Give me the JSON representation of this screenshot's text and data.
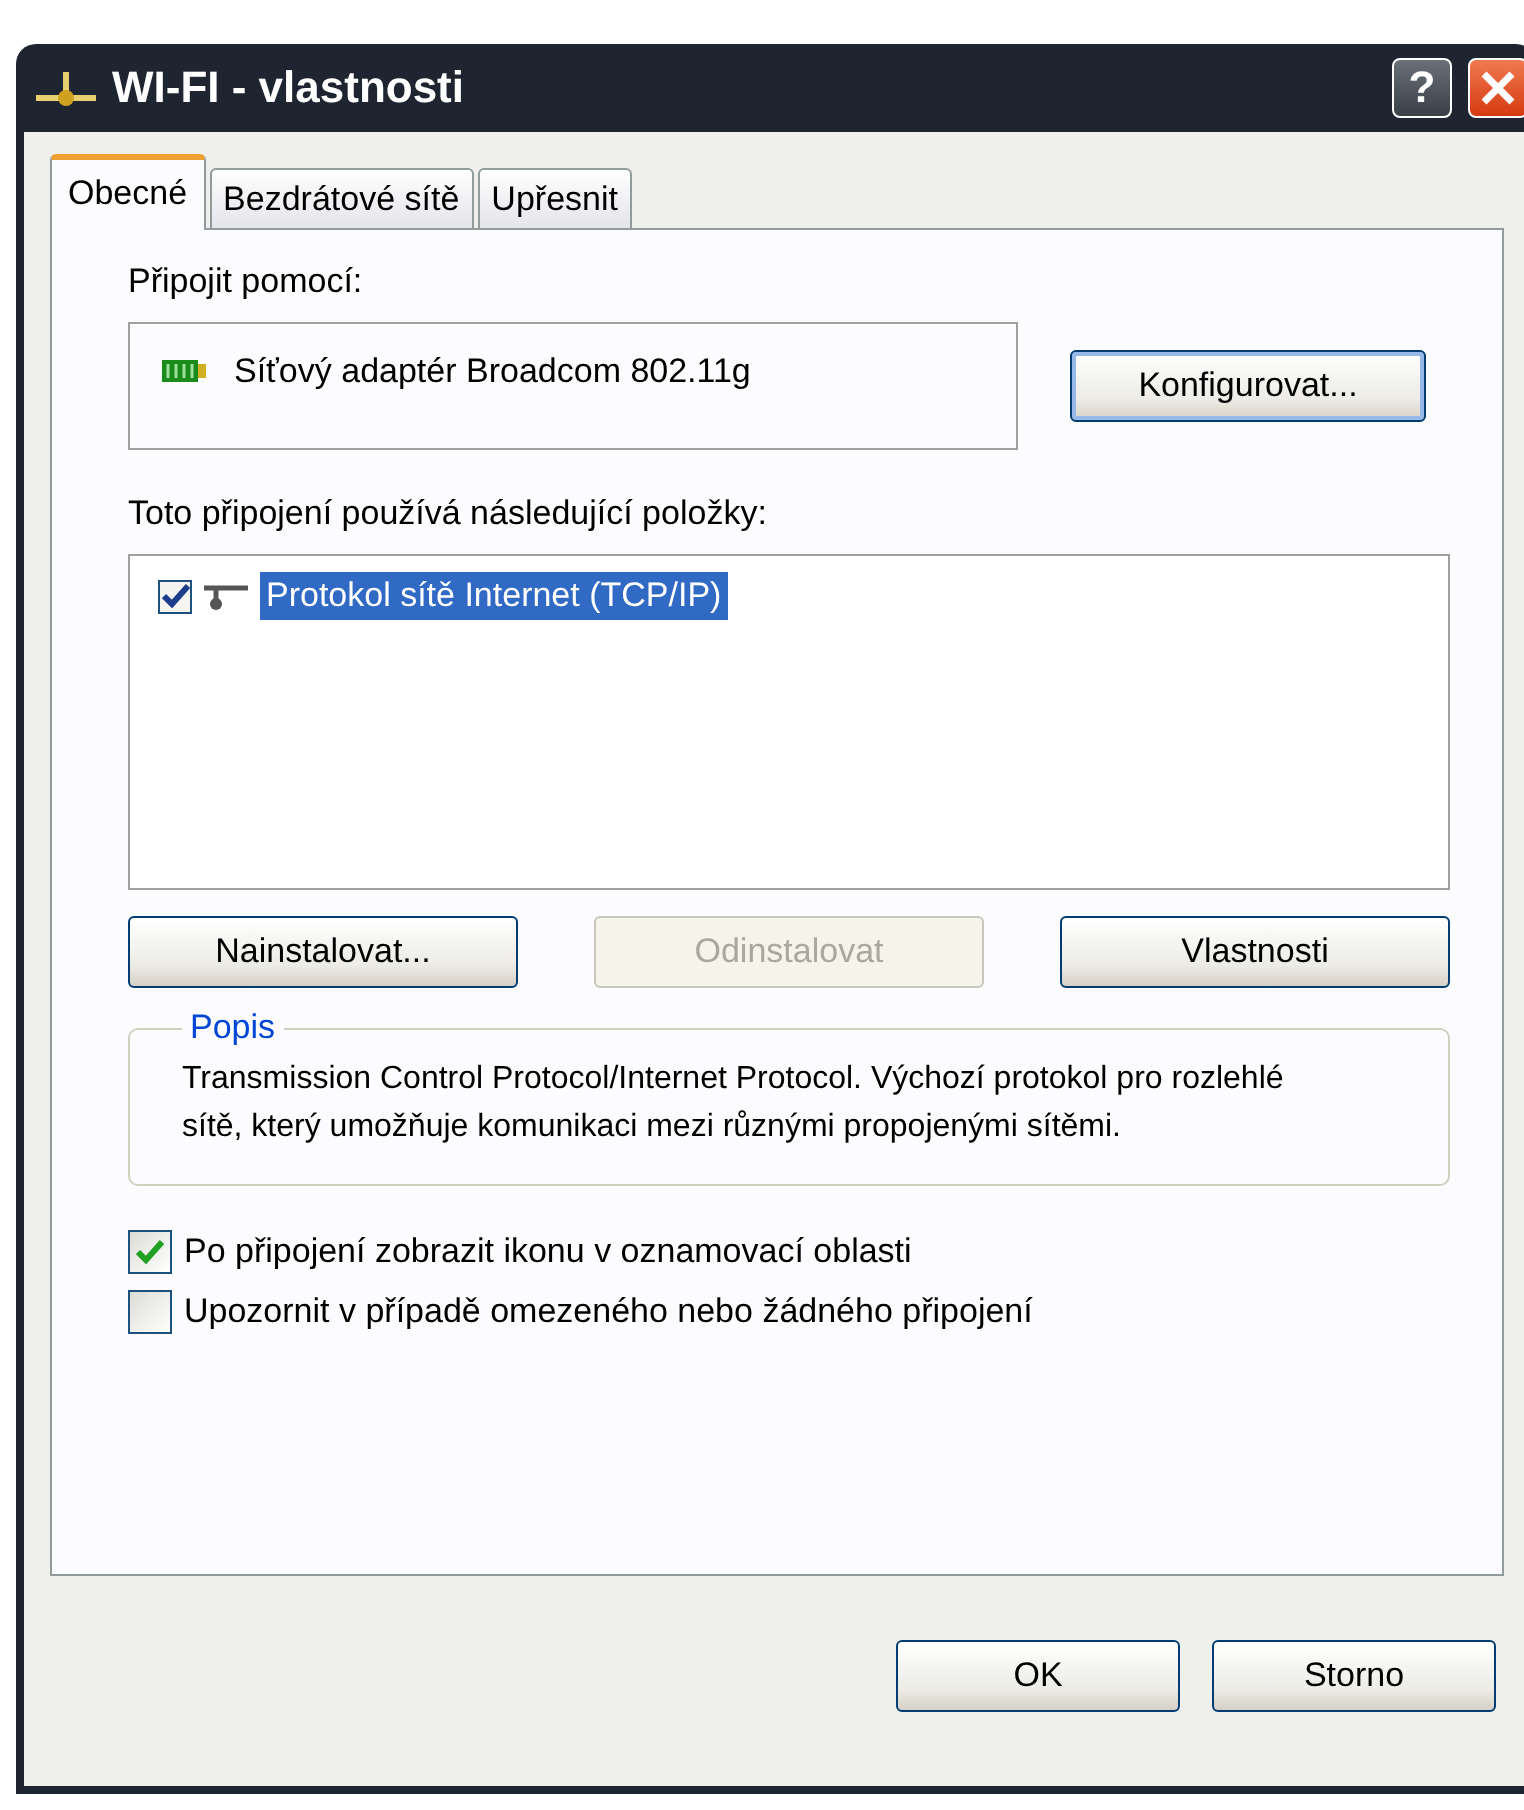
{
  "window": {
    "title": "WI-FI - vlastnosti",
    "help_button": "?"
  },
  "tabs": [
    {
      "label": "Obecné",
      "selected": true
    },
    {
      "label": "Bezdrátové sítě",
      "selected": false
    },
    {
      "label": "Upřesnit",
      "selected": false
    }
  ],
  "connect_using": {
    "label": "Připojit pomocí:",
    "adapter": "Síťový adaptér Broadcom 802.11g",
    "button": "Konfigurovat..."
  },
  "components": {
    "label": "Toto připojení používá následující položky:",
    "items": [
      {
        "name": "Protokol sítě Internet (TCP/IP)",
        "checked": true,
        "selected": true
      }
    ]
  },
  "component_buttons": [
    {
      "label": "Nainstalovat...",
      "disabled": false
    },
    {
      "label": "Odinstalovat",
      "disabled": true
    },
    {
      "label": "Vlastnosti",
      "disabled": false
    }
  ],
  "description": {
    "title": "Popis",
    "text": "Transmission Control Protocol/Internet Protocol. Výchozí protokol pro rozlehlé sítě, který umožňuje komunikaci mezi různými propojenými sítěmi."
  },
  "options": [
    {
      "label": "Po připojení zobrazit ikonu v oznamovací oblasti",
      "checked": true
    },
    {
      "label": "Upozornit v případě omezeného nebo žádného připojení",
      "checked": false
    }
  ],
  "dialog_buttons": [
    "OK",
    "Storno"
  ]
}
